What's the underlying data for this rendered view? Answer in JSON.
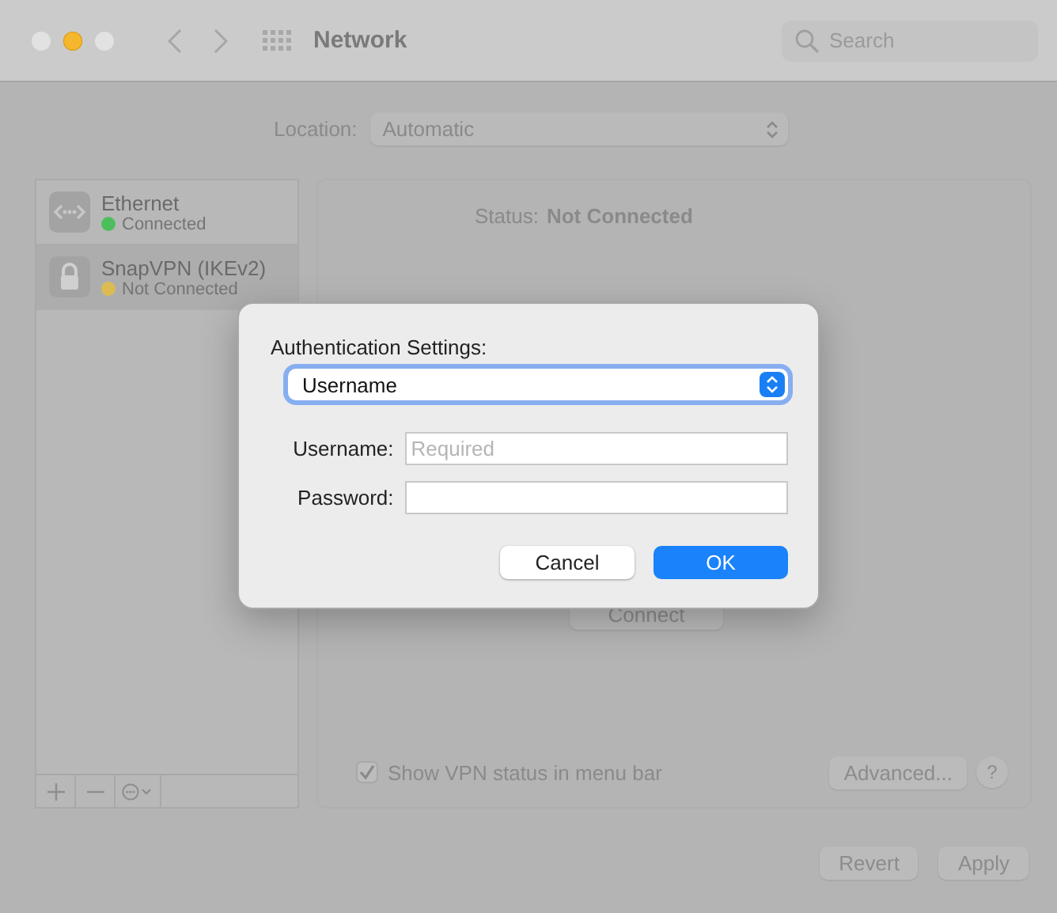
{
  "window": {
    "title": "Network",
    "search": {
      "placeholder": "Search"
    }
  },
  "location": {
    "label": "Location:",
    "value": "Automatic"
  },
  "services": [
    {
      "name": "Ethernet",
      "status": "Connected",
      "color": "#4cbf5c",
      "kind": "ethernet",
      "selected": false
    },
    {
      "name": "SnapVPN (IKEv2)",
      "status": "Not Connected",
      "color": "#dcbc52",
      "kind": "vpn",
      "selected": true
    }
  ],
  "status": {
    "label": "Status:",
    "value": "Not Connected"
  },
  "connect_button": "Connect",
  "show_vpn_status": {
    "label": "Show VPN status in menu bar",
    "checked": true
  },
  "advanced_button": "Advanced...",
  "help_button": "?",
  "revert_button": "Revert",
  "apply_button": "Apply",
  "dialog": {
    "title": "Authentication Settings:",
    "method": "Username",
    "fields": [
      {
        "label": "Username:",
        "placeholder": "Required"
      },
      {
        "label": "Password:"
      }
    ],
    "buttons": [
      {
        "label": "Cancel",
        "kind": "secondary"
      },
      {
        "label": "OK",
        "kind": "primary"
      }
    ]
  }
}
